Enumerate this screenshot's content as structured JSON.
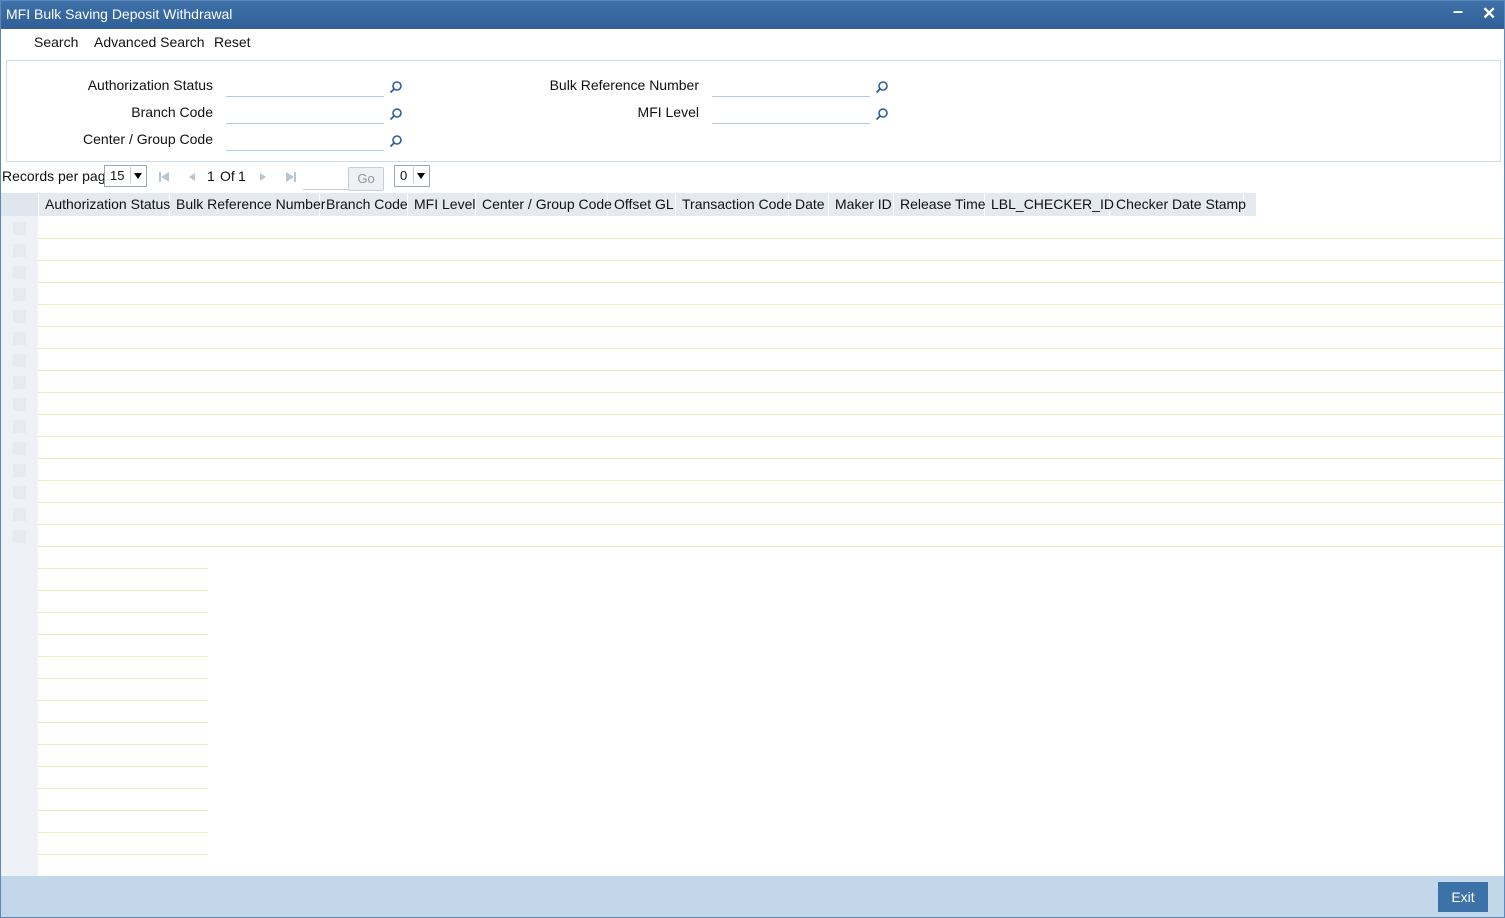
{
  "window": {
    "title": "MFI Bulk Saving Deposit Withdrawal",
    "minimize": "–",
    "close": "✕"
  },
  "toolbar": {
    "search": "Search",
    "advanced_search": "Advanced Search",
    "reset": "Reset"
  },
  "search_fields": {
    "authorization_status": {
      "label": "Authorization Status",
      "value": ""
    },
    "branch_code": {
      "label": "Branch Code",
      "value": ""
    },
    "center_group_code": {
      "label": "Center / Group Code",
      "value": ""
    },
    "bulk_reference_number": {
      "label": "Bulk Reference Number",
      "value": ""
    },
    "mfi_level": {
      "label": "MFI Level",
      "value": ""
    }
  },
  "pager": {
    "records_per_page_label": "Records per page",
    "records_per_page": "15",
    "current_page": "1",
    "of_label": "Of",
    "total_pages": "1",
    "page_input": "",
    "go_label": "Go",
    "secondary_select": "0"
  },
  "columns": [
    "Authorization Status",
    "Bulk Reference Number",
    "Branch Code",
    "MFI Level",
    "Center / Group Code",
    "Offset GL",
    "Transaction Code",
    "Date",
    "Maker ID",
    "Release Time",
    "LBL_CHECKER_ID",
    "Checker Date Stamp"
  ],
  "footer": {
    "exit_label": "Exit"
  },
  "colors": {
    "titlebar": "#3f71a8",
    "footer": "#c2d8ea",
    "exit_button": "#3c72a8",
    "grid_header": "#e4eaf0",
    "row_line": "#f4eebf"
  }
}
